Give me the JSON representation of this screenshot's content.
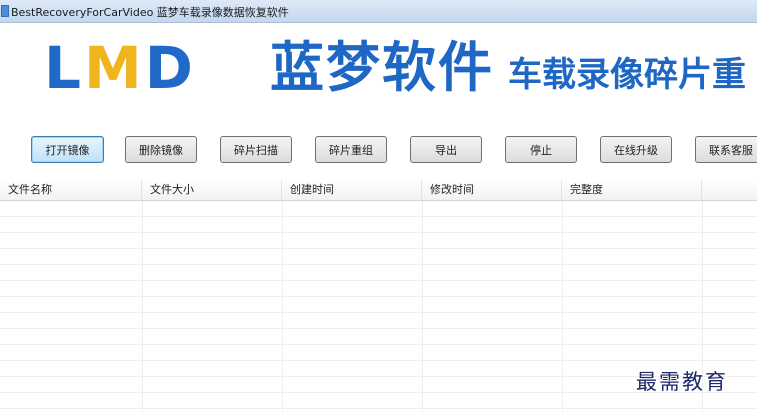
{
  "window": {
    "title": "BestRecoveryForCarVideo  蓝梦车载录像数据恢复软件"
  },
  "banner": {
    "logo_letters": [
      "L",
      "M",
      "D"
    ],
    "brand_name": "蓝梦软件",
    "subtitle": "车载录像碎片重",
    "colors": {
      "logo_blue": "#2069c9",
      "logo_gold": "#f0b51d"
    }
  },
  "toolbar": {
    "buttons": [
      {
        "label": "打开镜像"
      },
      {
        "label": "删除镜像"
      },
      {
        "label": "碎片扫描"
      },
      {
        "label": "碎片重组"
      },
      {
        "label": "导出"
      },
      {
        "label": "停止"
      },
      {
        "label": "在线升级"
      },
      {
        "label": "联系客服"
      }
    ]
  },
  "file_table": {
    "columns": [
      "文件名称",
      "文件大小",
      "创建时间",
      "修改时间",
      "完整度"
    ],
    "rows": []
  },
  "watermark": "最需教育"
}
